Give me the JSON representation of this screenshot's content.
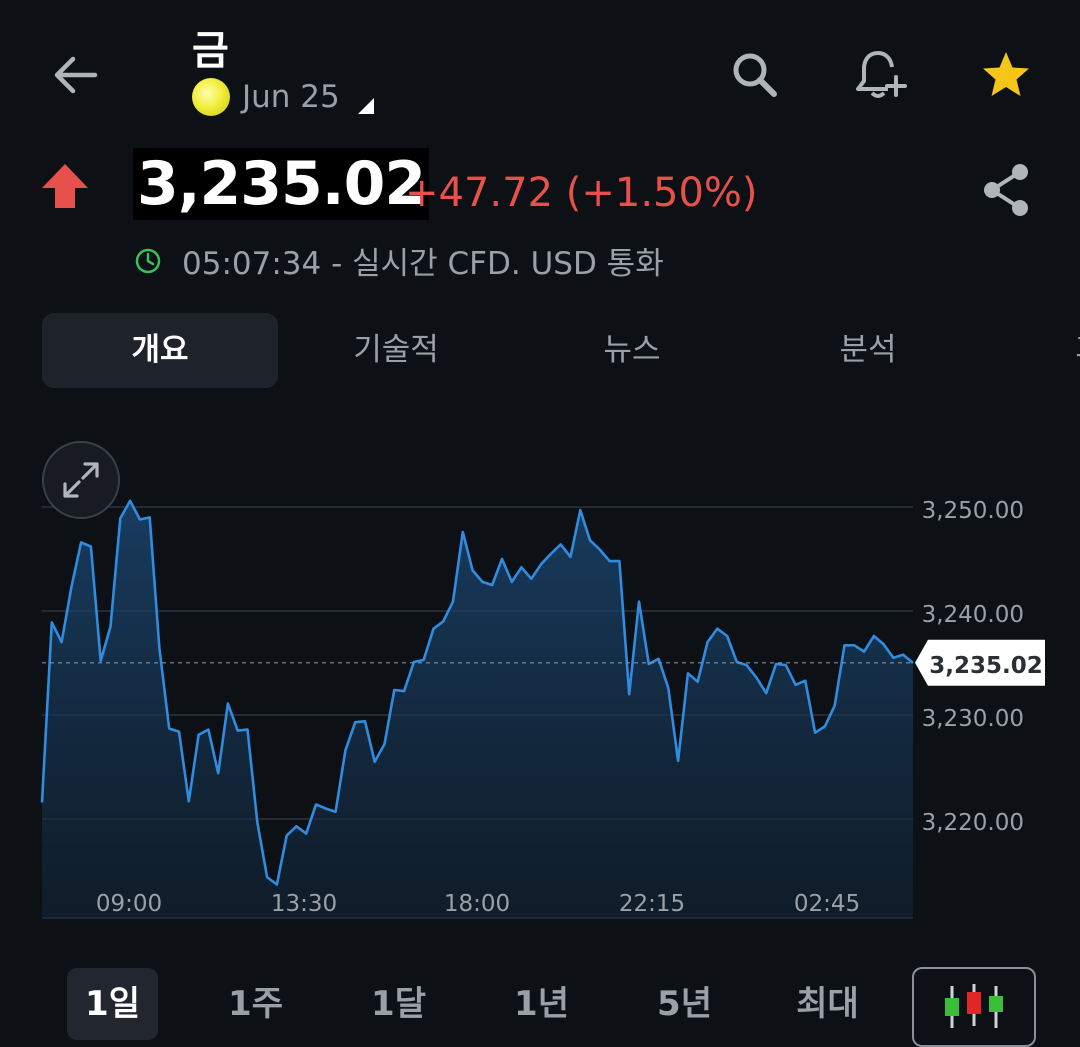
{
  "header": {
    "title": "금",
    "expiry_label": "Jun 25",
    "icons": {
      "back": "arrow-left-icon",
      "search": "search-icon",
      "alert": "add-alert-bell-icon",
      "favorite": "star-icon"
    },
    "star_color": "#f5c518"
  },
  "quote": {
    "price": "3,235.02",
    "change": "+47.72 (+1.50%)",
    "change_color": "#e8514b",
    "time_info": "05:07:34 - 실시간 CFD. USD 통화"
  },
  "tabs": [
    {
      "label": "개요",
      "active": true
    },
    {
      "label": "기술적",
      "active": false
    },
    {
      "label": "뉴스",
      "active": false
    },
    {
      "label": "분석",
      "active": false
    },
    {
      "label": "과거",
      "active": false
    }
  ],
  "chart_data": {
    "type": "area",
    "x_ticks": [
      "09:00",
      "13:30",
      "18:00",
      "22:15",
      "02:45"
    ],
    "y_ticks": [
      "3,250.00",
      "3,240.00",
      "3,230.00",
      "3,220.00"
    ],
    "ylim": [
      3210,
      3254
    ],
    "current_label": "3,235.02",
    "current_value": 3235.02,
    "line_color": "#2f8ce0",
    "values": [
      3221.6,
      3238.9,
      3237.0,
      3242.3,
      3246.6,
      3246.2,
      3235.2,
      3238.5,
      3248.9,
      3250.6,
      3248.8,
      3249.0,
      3236.4,
      3228.7,
      3228.4,
      3221.7,
      3228.1,
      3228.6,
      3224.4,
      3231.1,
      3228.5,
      3228.6,
      3219.7,
      3214.4,
      3213.7,
      3218.4,
      3219.3,
      3218.6,
      3221.4,
      3221.0,
      3220.7,
      3226.6,
      3229.3,
      3229.4,
      3225.5,
      3227.2,
      3232.4,
      3232.3,
      3235.1,
      3235.3,
      3238.3,
      3239.0,
      3240.9,
      3247.6,
      3243.9,
      3242.8,
      3242.5,
      3245.0,
      3242.8,
      3244.2,
      3243.1,
      3244.5,
      3245.5,
      3246.4,
      3245.2,
      3249.7,
      3246.8,
      3245.9,
      3244.8,
      3244.8,
      3232.0,
      3240.9,
      3234.9,
      3235.4,
      3232.6,
      3225.6,
      3234.0,
      3233.2,
      3237.0,
      3238.3,
      3237.6,
      3235.1,
      3234.8,
      3233.6,
      3232.1,
      3234.9,
      3234.8,
      3232.9,
      3233.3,
      3228.3,
      3228.9,
      3230.9,
      3236.7,
      3236.7,
      3236.1,
      3237.6,
      3236.8,
      3235.5,
      3235.8,
      3235.0
    ]
  },
  "ranges": [
    {
      "label": "1일",
      "active": true
    },
    {
      "label": "1주",
      "active": false
    },
    {
      "label": "1달",
      "active": false
    },
    {
      "label": "1년",
      "active": false
    },
    {
      "label": "5년",
      "active": false
    },
    {
      "label": "최대",
      "active": false
    }
  ]
}
